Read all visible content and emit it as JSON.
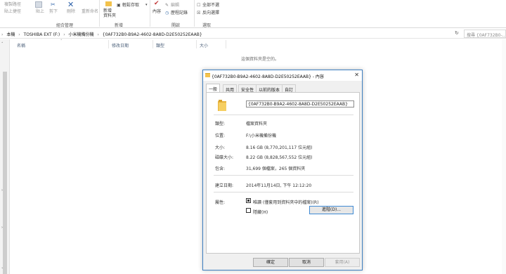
{
  "ribbon": {
    "clipboard": {
      "copy_path": "複製路徑",
      "paste_shortcut": "貼上捷徑",
      "paste": "貼上",
      "cut": "剪下",
      "group": "組合管理"
    },
    "organize": {
      "copy_to": "複製到",
      "delete": "刪除",
      "rename": "重新命名"
    },
    "new": {
      "new_folder": "新增\n資料夾",
      "easy_access": "輕鬆存取",
      "group": "新增"
    },
    "open": {
      "properties": "內容",
      "edit": "編輯",
      "history": "歷程記錄",
      "group": "開啟"
    },
    "select": {
      "select_all": "全部不選",
      "select_none": "全部不選",
      "invert": "反向選擇",
      "group": "選取"
    }
  },
  "address": {
    "crumbs": [
      "本機",
      "TOSHIBA EXT (F:)",
      "小米機備份機",
      "{0AF732B0-B9A2-4602-8A8D-D2E50252EAAB}"
    ],
    "search_placeholder": "搜尋 {0AF732B0-..."
  },
  "columns": [
    "名稱",
    "修改日期",
    "類型",
    "大小"
  ],
  "empty_text": "這個資料夾是空的。",
  "dialog": {
    "title": "{0AF732B0-B9A2-4602-8A8D-D2E50252EAAB} - 內容",
    "tabs": [
      "一般",
      "共用",
      "安全性",
      "以前的版本",
      "自訂"
    ],
    "name_value": "{0AF732B0-B9A2-4602-8A8D-D2E50252EAAB}",
    "type_label": "類型:",
    "type_value": "檔案資料夾",
    "location_label": "位置:",
    "location_value": "F:\\小米機備份機",
    "size_label": "大小:",
    "size_value": "8.16 GB (8,770,201,117 位元組)",
    "disk_size_label": "磁碟大小:",
    "disk_size_value": "8.22 GB (8,828,567,552 位元組)",
    "contains_label": "包含:",
    "contains_value": "31,699 個檔案，265 個資料夾",
    "created_label": "建立日期:",
    "created_value": "2014年11月14日, 下午 12:12:20",
    "attributes_label": "屬性:",
    "readonly_label": "唯讀 (僅套用到資料夾中的檔案)(R)",
    "hidden_label": "隱藏(H)",
    "advanced_label": "進階(D)...",
    "ok_label": "確定",
    "cancel_label": "取消",
    "apply_label": "套用(A)"
  }
}
